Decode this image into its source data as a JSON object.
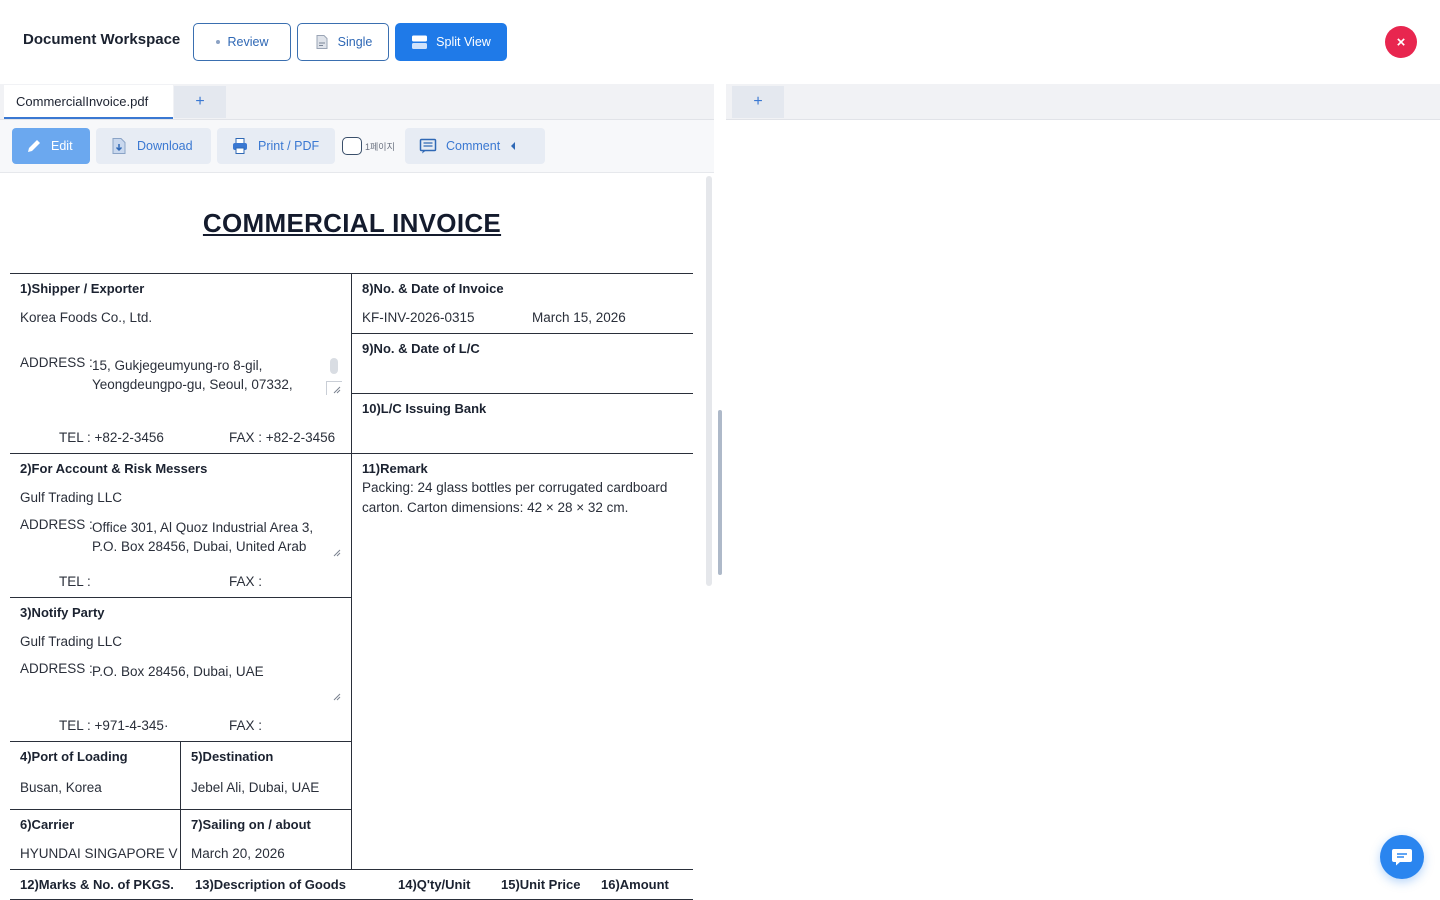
{
  "header": {
    "title": "Document Workspace",
    "modes": {
      "review": "Review",
      "single": "Single",
      "split": "Split View"
    },
    "close_icon": "×"
  },
  "left_pane": {
    "tab": "CommercialInvoice.pdf",
    "add_tab": "+",
    "toolbar": {
      "edit": "Edit",
      "download": "Download",
      "print": "Print / PDF",
      "page_label": "1페이지",
      "comment": "Comment"
    }
  },
  "right_pane": {
    "add_tab": "+"
  },
  "invoice": {
    "title": "COMMERCIAL INVOICE",
    "shipper": {
      "label": "1)Shipper / Exporter",
      "name": "Korea Foods Co., Ltd.",
      "address_label": "ADDRESS :",
      "address": "15, Gukjegeumyung-ro 8-gil,\nYeongdeungpo-gu, Seoul, 07332,",
      "tel": "TEL : +82-2-3456",
      "fax": "FAX : +82-2-3456"
    },
    "account": {
      "label": "2)For Account & Risk Messers",
      "name": "Gulf Trading LLC",
      "address_label": "ADDRESS :",
      "address": "Office 301, Al Quoz Industrial Area 3,\nP.O. Box 28456, Dubai, United Arab",
      "tel": "TEL :",
      "fax": "FAX :"
    },
    "notify": {
      "label": "3)Notify Party",
      "name": "Gulf Trading LLC",
      "address_label": "ADDRESS :",
      "address": "P.O. Box 28456, Dubai, UAE",
      "tel": "TEL : +971-4-345·",
      "fax": "FAX :"
    },
    "port_loading": {
      "label": "4)Port of Loading",
      "value": "Busan, Korea"
    },
    "destination": {
      "label": "5)Destination",
      "value": "Jebel Ali, Dubai, UAE"
    },
    "carrier": {
      "label": "6)Carrier",
      "value": "HYUNDAI SINGAPORE V"
    },
    "sailing": {
      "label": "7)Sailing on / about",
      "value": "March 20, 2026"
    },
    "invoice_no": {
      "label": "8)No. & Date of Invoice",
      "number": "KF-INV-2026-0315",
      "date": "March 15, 2026"
    },
    "lc": {
      "label": "9)No. & Date of L/C"
    },
    "lc_bank": {
      "label": "10)L/C Issuing Bank"
    },
    "remark": {
      "label": "11)Remark",
      "line1": "Packing: 24 glass bottles per corrugated cardboard",
      "line2": "carton. Carton dimensions: 42 × 28 × 32 cm."
    },
    "columns": {
      "marks": "12)Marks & No. of PKGS.",
      "description": "13)Description of Goods",
      "qty": "14)Q'ty/Unit",
      "unit_price": "15)Unit Price",
      "amount": "16)Amount"
    }
  }
}
